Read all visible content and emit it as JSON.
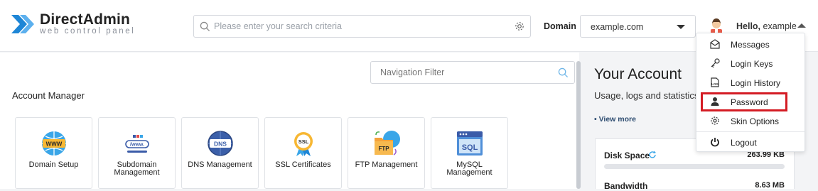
{
  "header": {
    "logo_title": "DirectAdmin",
    "logo_subtitle": "web control panel",
    "search_placeholder": "Please enter your search criteria",
    "domain_label": "Domain",
    "domain_value": "example.com",
    "hello_prefix": "Hello,",
    "username": "example"
  },
  "nav_filter": {
    "placeholder": "Navigation Filter"
  },
  "account_manager": {
    "title": "Account Manager",
    "tiles": [
      {
        "label": "Domain Setup",
        "icon": "www-icon"
      },
      {
        "label": "Subdomain Management",
        "icon": "subdomain-icon"
      },
      {
        "label": "DNS Management",
        "icon": "dns-globe-icon"
      },
      {
        "label": "SSL Certificates",
        "icon": "ssl-badge-icon"
      },
      {
        "label": "FTP Management",
        "icon": "ftp-folder-icon"
      },
      {
        "label": "MySQL Management",
        "icon": "sql-window-icon"
      }
    ]
  },
  "your_account": {
    "title": "Your Account",
    "subtitle": "Usage, logs and statistics",
    "view_more": "• View more",
    "disk_space_label": "Disk Space",
    "disk_space_value": "263.99 KB",
    "disk_space_fraction": 0.0,
    "bandwidth_label": "Bandwidth",
    "bandwidth_value": "8.63 MB"
  },
  "user_menu": {
    "items": [
      {
        "label": "Messages",
        "icon": "envelope-icon"
      },
      {
        "label": "Login Keys",
        "icon": "key-icon"
      },
      {
        "label": "Login History",
        "icon": "log-file-icon"
      },
      {
        "label": "Password",
        "icon": "user-icon"
      },
      {
        "label": "Skin Options",
        "icon": "gear-icon"
      },
      {
        "label": "Logout",
        "icon": "power-icon"
      }
    ],
    "highlighted_item": "Password",
    "highlight_color": "#d41c24"
  },
  "colors": {
    "logo_blue": "#1e86d6",
    "link_blue": "#2b4a6f",
    "progress_fill": "#3a8fd8"
  }
}
